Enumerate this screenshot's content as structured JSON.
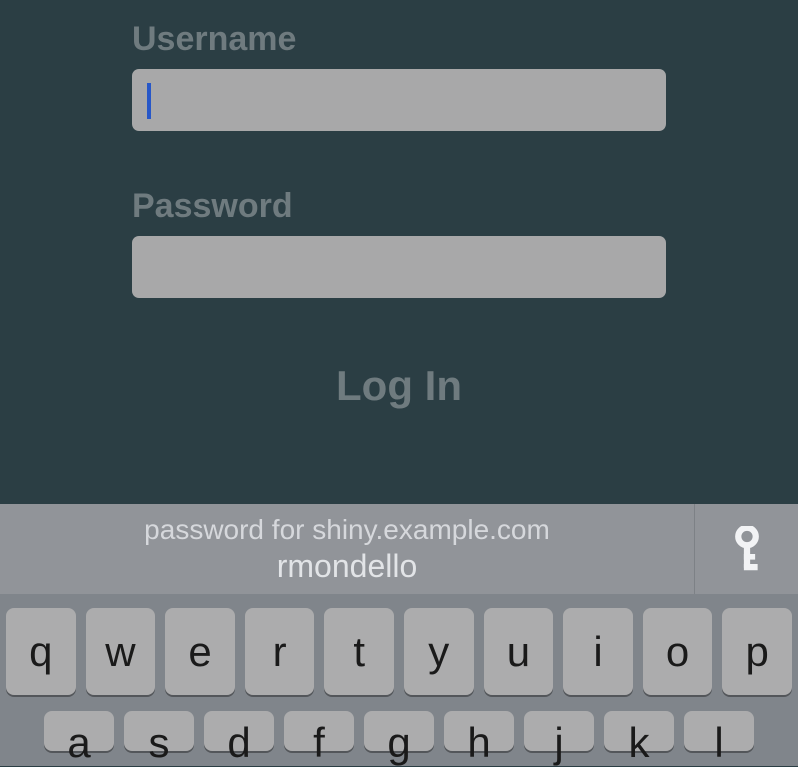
{
  "form": {
    "username_label": "Username",
    "username_value": "",
    "password_label": "Password",
    "password_value": "",
    "login_button": "Log In"
  },
  "autofill": {
    "label": "password for shiny.example.com",
    "username": "rmondello"
  },
  "keyboard": {
    "row1": [
      "q",
      "w",
      "e",
      "r",
      "t",
      "y",
      "u",
      "i",
      "o",
      "p"
    ],
    "row2": [
      "a",
      "s",
      "d",
      "f",
      "g",
      "h",
      "j",
      "k",
      "l"
    ]
  }
}
